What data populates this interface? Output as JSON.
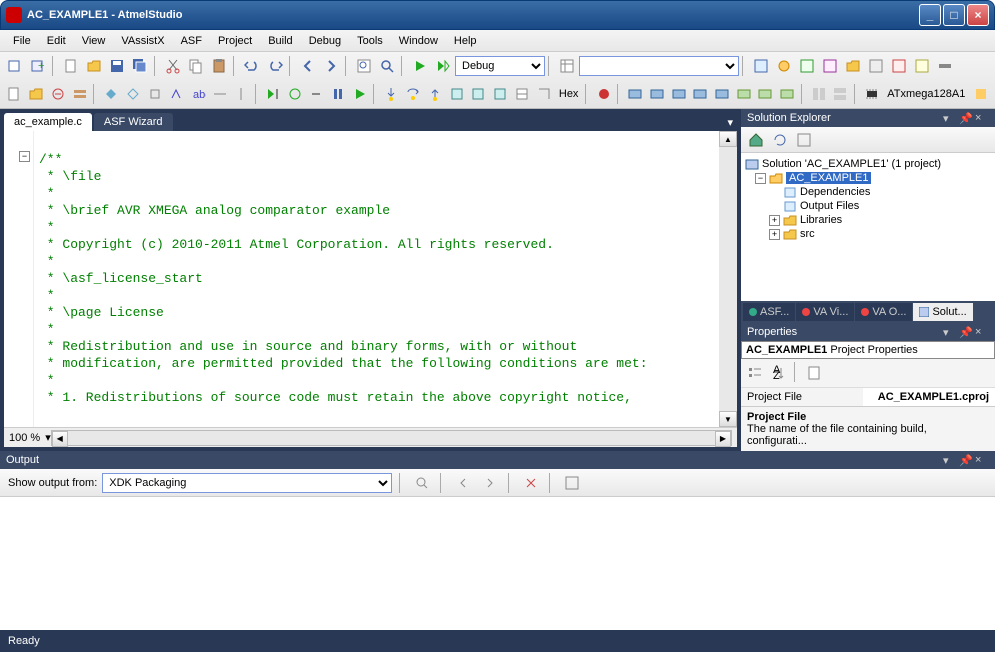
{
  "window": {
    "title": "AC_EXAMPLE1 - AtmelStudio"
  },
  "menu": [
    "File",
    "Edit",
    "View",
    "VAssistX",
    "ASF",
    "Project",
    "Build",
    "Debug",
    "Tools",
    "Window",
    "Help"
  ],
  "toolbar": {
    "config_dropdown": "Debug",
    "device_label": "ATxmega128A1",
    "hex_label": "Hex"
  },
  "tabs": [
    {
      "label": "ac_example.c",
      "active": true
    },
    {
      "label": "ASF Wizard",
      "active": false
    }
  ],
  "code": "/**\n * \\file\n *\n * \\brief AVR XMEGA analog comparator example\n *\n * Copyright (c) 2010-2011 Atmel Corporation. All rights reserved.\n *\n * \\asf_license_start\n *\n * \\page License\n *\n * Redistribution and use in source and binary forms, with or without\n * modification, are permitted provided that the following conditions are met:\n *\n * 1. Redistributions of source code must retain the above copyright notice,",
  "zoom": "100 %",
  "solution_explorer": {
    "title": "Solution Explorer",
    "root": "Solution 'AC_EXAMPLE1' (1 project)",
    "project": "AC_EXAMPLE1",
    "nodes": [
      "Dependencies",
      "Output Files",
      "Libraries",
      "src"
    ]
  },
  "panel_tabs": [
    {
      "label": "ASF...",
      "color": "#3a8"
    },
    {
      "label": "VA Vi...",
      "color": "#e44"
    },
    {
      "label": "VA O...",
      "color": "#e44"
    },
    {
      "label": "Solut...",
      "color": "",
      "active": true
    }
  ],
  "properties": {
    "title": "Properties",
    "combo_bold": "AC_EXAMPLE1",
    "combo_rest": " Project Properties",
    "row_key": "Project File",
    "row_val": "AC_EXAMPLE1.cproj",
    "desc_head": "Project File",
    "desc_body": "The name of the file containing build, configurati..."
  },
  "output": {
    "title": "Output",
    "label": "Show output from:",
    "source": "XDK Packaging"
  },
  "status": "Ready"
}
